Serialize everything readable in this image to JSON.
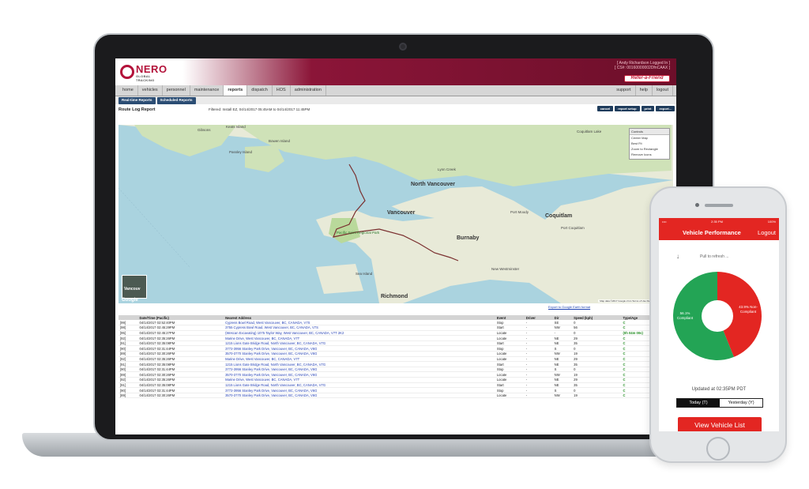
{
  "app": {
    "brand": "NERO",
    "brand_sub": "GLOBAL TRACKING",
    "user_line": "[ Andy Richardson Logged In ]",
    "cs_line": "[ CS#: 00160000002DfnCAAX ]",
    "refer_label": "Refer-a-Friend"
  },
  "nav": {
    "tabs": [
      "home",
      "vehicles",
      "personnel",
      "maintenance",
      "reports",
      "dispatch",
      "HOS",
      "administration"
    ],
    "active_tab": "reports",
    "right": [
      "support",
      "help",
      "logout"
    ]
  },
  "subnav": [
    "Real-time Reports",
    "Scheduled Reports"
  ],
  "report": {
    "title": "Route Log Report",
    "filter": "Filtered: Install EZ, 04/14/2017 05:45AM to 04/14/2017 11:45PM",
    "buttons": [
      "cancel",
      "report setup",
      "print",
      "export..."
    ]
  },
  "map": {
    "controls_title": "Controls",
    "controls_items": [
      "Center Map",
      "Best Fit",
      "Zoom to Rectangle",
      "Remove Icons"
    ],
    "labels": [
      "Gibsons",
      "Keats Island",
      "Bowen Island",
      "Passley Island",
      "Lynn Creek",
      "North Vancouver",
      "Vancouver",
      "Burnaby",
      "Port Moody",
      "Coquitlam",
      "Port Coquitlam",
      "New Westminster",
      "Sea Island",
      "Richmond",
      "Pacific Spirit Regional Park",
      "Coquitlam Lake"
    ],
    "thumb_label": "Vancouv",
    "google_mark": "Google",
    "footer": "Map data ©2017 Google   2 km   Terms of Use   Report a map error",
    "export_link": "Export to Google Earth format"
  },
  "table": {
    "columns": [
      "",
      "Date/Time (Pacific)",
      "Nearest Address",
      "Event",
      "Driver",
      "Dir",
      "Speed (kph)",
      "Type/Age"
    ],
    "rows": [
      [
        "[99]",
        "04/14/2017 02:52:40PM",
        "Cypress Bowl Road, West Vancouver, BC, CANADA, V7S",
        "Stop",
        "-",
        "SE",
        "0",
        "C"
      ],
      [
        "[98]",
        "04/14/2017 02:45:29PM",
        "3755 Cypress Bowl Road, West Vancouver, BC, CANADA, V7S",
        "Start",
        "-",
        "NW",
        "56",
        "C"
      ],
      [
        "[95]",
        "04/14/2017 02:45:27PM",
        "(Wescan Excavating) 1075 Taylor Way, West Vancouver, BC, CANADA, V7T 2K2",
        "Locate",
        "-",
        "-",
        "0",
        "(0h 04m 00s)"
      ],
      [
        "[92]",
        "04/14/2017 02:35:26PM",
        "Marine Drive, West Vancouver, BC, CANADA, V7T",
        "Locate",
        "-",
        "NE",
        "29",
        "C"
      ],
      [
        "[91]",
        "04/14/2017 02:35:08PM",
        "1215 Lions Gate Bridge Road, North Vancouver, BC, CANADA, V7G",
        "Start",
        "-",
        "NE",
        "35",
        "C"
      ],
      [
        "[90]",
        "04/14/2017 02:31:44PM",
        "3772-3956 Stanley Park Drive, Vancouver, BC, CANADA, V6G",
        "Stop",
        "-",
        "S",
        "0",
        "C"
      ],
      [
        "[89]",
        "04/14/2017 02:30:26PM",
        "3570-3770 Stanley Park Drive, Vancouver, BC, CANADA, V6G",
        "Locate",
        "-",
        "NW",
        "19",
        "C"
      ],
      [
        "[92]",
        "04/14/2017 02:35:26PM",
        "Marine Drive, West Vancouver, BC, CANADA, V7T",
        "Locate",
        "-",
        "NE",
        "29",
        "C"
      ],
      [
        "[91]",
        "04/14/2017 02:35:08PM",
        "1215 Lions Gate Bridge Road, North Vancouver, BC, CANADA, V7G",
        "Start",
        "-",
        "NE",
        "35",
        "C"
      ],
      [
        "[90]",
        "04/14/2017 02:31:44PM",
        "3772-3956 Stanley Park Drive, Vancouver, BC, CANADA, V6G",
        "Stop",
        "-",
        "S",
        "0",
        "C"
      ],
      [
        "[89]",
        "04/14/2017 02:30:26PM",
        "3570-3770 Stanley Park Drive, Vancouver, BC, CANADA, V6G",
        "Locate",
        "-",
        "NW",
        "19",
        "C"
      ],
      [
        "[92]",
        "04/14/2017 02:35:26PM",
        "Marine Drive, West Vancouver, BC, CANADA, V7T",
        "Locate",
        "-",
        "NE",
        "29",
        "C"
      ],
      [
        "[91]",
        "04/14/2017 02:35:08PM",
        "1215 Lions Gate Bridge Road, North Vancouver, BC, CANADA, V7G",
        "Start",
        "-",
        "NE",
        "35",
        "C"
      ],
      [
        "[90]",
        "04/14/2017 02:31:44PM",
        "3772-3956 Stanley Park Drive, Vancouver, BC, CANADA, V6G",
        "Stop",
        "-",
        "S",
        "0",
        "C"
      ],
      [
        "[89]",
        "04/14/2017 02:30:26PM",
        "3570-3770 Stanley Park Drive, Vancouver, BC, CANADA, V6G",
        "Locate",
        "-",
        "NW",
        "19",
        "C"
      ]
    ]
  },
  "phone": {
    "status_time": "2:35 PM",
    "status_carrier": "•••• ",
    "status_battery": "100%",
    "title": "Vehicle Performance",
    "logout": "Logout",
    "pull_text": "Pull to refresh ...",
    "pie": {
      "compliant_pct": 56.1,
      "non_compliant_pct": 43.9,
      "compliant_label": "56.1% Compliant",
      "non_compliant_label": "43.9% Non-Compliant",
      "compliant_color": "#23a455",
      "non_compliant_color": "#e32622"
    },
    "updated": "Updated at 02:35PM PDT",
    "toggle": [
      "Today (T)",
      "Yesterday (Y)"
    ],
    "view_button": "View Vehicle List"
  }
}
